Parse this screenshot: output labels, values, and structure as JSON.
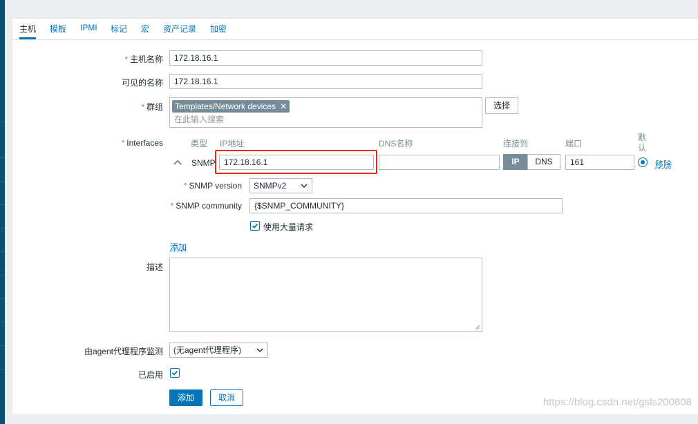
{
  "tabs": [
    {
      "label": "主机",
      "active": true
    },
    {
      "label": "模板"
    },
    {
      "label": "IPMI"
    },
    {
      "label": "标记"
    },
    {
      "label": "宏"
    },
    {
      "label": "资产记录"
    },
    {
      "label": "加密"
    }
  ],
  "form": {
    "required_mark": "*",
    "host_name_label": "主机名称",
    "host_name_value": "172.18.16.1",
    "visible_name_label": "可见的名称",
    "visible_name_value": "172.18.16.1",
    "groups_label": "群组",
    "group_tag": "Templates/Network devices",
    "group_tag_remove": "✕",
    "groups_placeholder": "在此输入搜索",
    "select_button": "选择",
    "interfaces_label": "Interfaces",
    "interfaces": {
      "col_type": "类型",
      "col_ip": "IP地址",
      "col_dns": "DNS名称",
      "col_connect": "连接到",
      "col_port": "端口",
      "col_default": "默认",
      "row_type": "SNMP",
      "row_ip": "172.18.16.1",
      "row_dns": "",
      "connect_ip": "IP",
      "connect_dns": "DNS",
      "row_port": "161",
      "remove_link": "移除"
    },
    "snmp_version_label": "SNMP version",
    "snmp_version_value": "SNMPv2",
    "snmp_community_label": "SNMP community",
    "snmp_community_value": "{$SNMP_COMMUNITY}",
    "bulk_label": "使用大量请求",
    "bulk_checked": true,
    "add_link": "添加",
    "description_label": "描述",
    "description_value": "",
    "proxy_label": "由agent代理程序监测",
    "proxy_value": "(无agent代理程序)",
    "enabled_label": "已启用",
    "enabled_checked": true,
    "add_button": "添加",
    "cancel_button": "取消"
  },
  "watermark": "https://blog.csdn.net/gsls200808",
  "colors": {
    "accent": "#0275b8",
    "required": "#e45959",
    "highlight": "#e8251d",
    "tag_bg": "#768d99"
  }
}
